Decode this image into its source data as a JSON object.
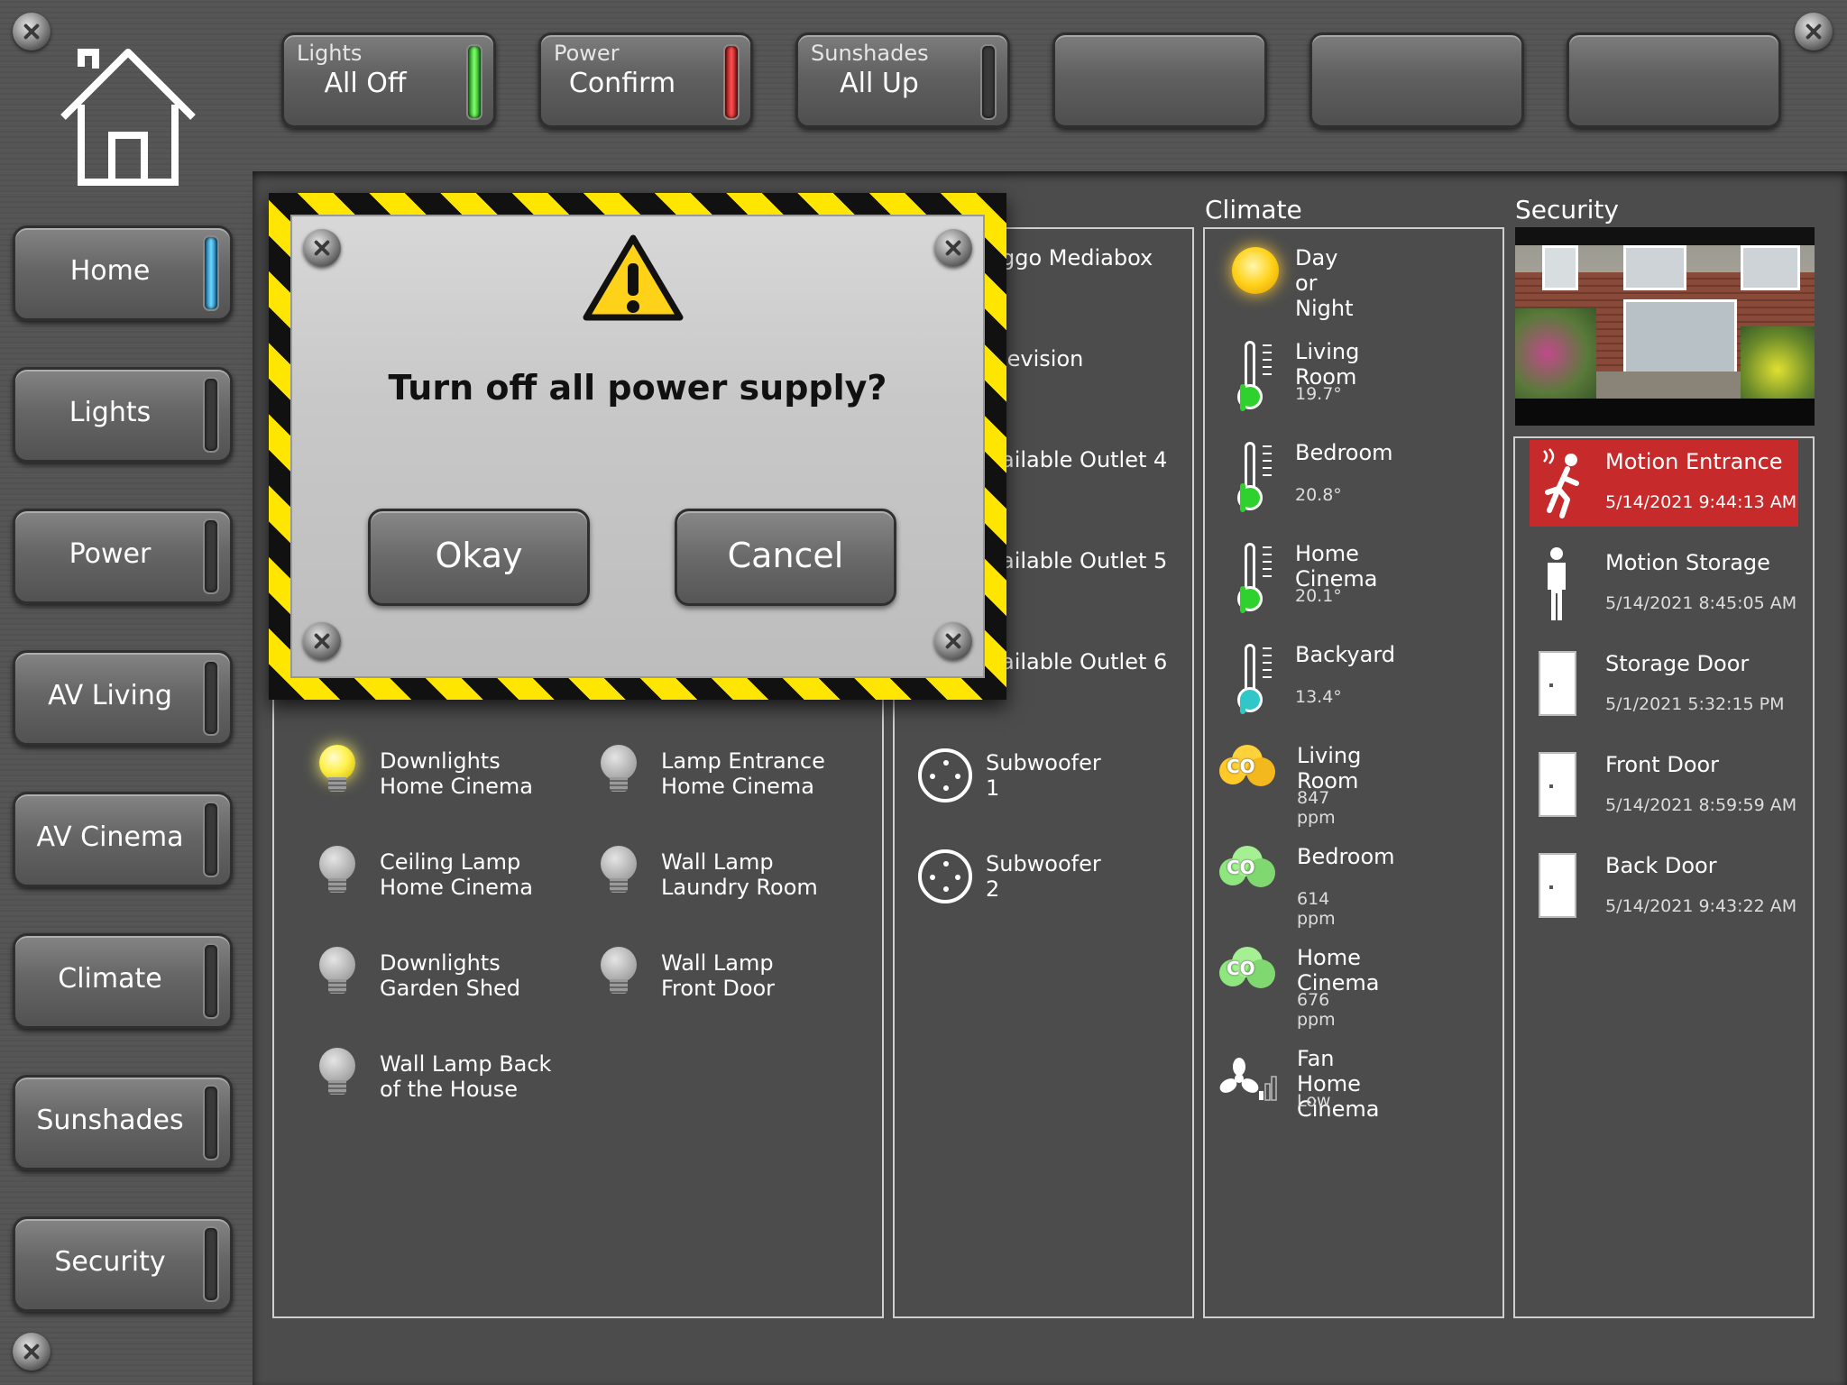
{
  "top_buttons": [
    {
      "caption": "Lights",
      "value": "All Off",
      "indicator": "green"
    },
    {
      "caption": "Power",
      "value": "Confirm",
      "indicator": "red"
    },
    {
      "caption": "Sunshades",
      "value": "All Up",
      "indicator": "gray"
    },
    {
      "caption": "",
      "value": ""
    },
    {
      "caption": "",
      "value": ""
    },
    {
      "caption": "",
      "value": ""
    }
  ],
  "nav": [
    {
      "label": "Home",
      "active": true
    },
    {
      "label": "Lights"
    },
    {
      "label": "Power"
    },
    {
      "label": "AV Living"
    },
    {
      "label": "AV Cinema"
    },
    {
      "label": "Climate"
    },
    {
      "label": "Sunshades"
    },
    {
      "label": "Security"
    }
  ],
  "lights": [
    {
      "line1": "Downlights",
      "line2": "Home Cinema",
      "on": true
    },
    {
      "line1": "Lamp Entrance",
      "line2": "Home Cinema",
      "on": false
    },
    {
      "line1": "Ceiling Lamp",
      "line2": "Home Cinema",
      "on": false
    },
    {
      "line1": "Wall Lamp",
      "line2": "Laundry Room",
      "on": false
    },
    {
      "line1": "Downlights",
      "line2": "Garden Shed",
      "on": false
    },
    {
      "line1": "Wall Lamp",
      "line2": "Front Door",
      "on": false
    },
    {
      "line1": "Wall Lamp Back",
      "line2": "of the House",
      "on": false
    }
  ],
  "power": [
    {
      "label": "ggo Mediabox"
    },
    {
      "label": "levision"
    },
    {
      "label": "ailable Outlet 4"
    },
    {
      "label": "ailable Outlet 5"
    },
    {
      "label": "ailable Outlet 6"
    },
    {
      "label": "Subwoofer 1"
    },
    {
      "label": "Subwoofer 2"
    }
  ],
  "climate": {
    "title": "Climate",
    "day_night": "Day or Night",
    "temperatures": [
      {
        "name": "Living Room",
        "value": "19.7°",
        "color": "#2fd12f"
      },
      {
        "name": "Bedroom",
        "value": "20.8°",
        "color": "#2fd12f"
      },
      {
        "name": "Home Cinema",
        "value": "20.1°",
        "color": "#2fd12f"
      },
      {
        "name": "Backyard",
        "value": "13.4°",
        "color": "#2fc7c7"
      }
    ],
    "co2": [
      {
        "name": "Living Room",
        "value": "847 ppm",
        "level": "yellow"
      },
      {
        "name": "Bedroom",
        "value": "614 ppm",
        "level": "green"
      },
      {
        "name": "Home Cinema",
        "value": "676 ppm",
        "level": "green"
      }
    ],
    "co2_glyph": "CO",
    "fan": {
      "name": "Fan Home Cinema",
      "value": "Low"
    }
  },
  "security": {
    "title": "Security",
    "events": [
      {
        "name": "Motion Entrance",
        "time": "5/14/2021 9:44:13 AM",
        "alert": true,
        "icon": "motion-running-icon"
      },
      {
        "name": "Motion Storage",
        "time": "5/14/2021 8:45:05 AM",
        "alert": false,
        "icon": "person-standing-icon"
      },
      {
        "name": "Storage Door",
        "time": "5/1/2021 5:32:15 PM",
        "alert": false,
        "icon": "door-icon"
      },
      {
        "name": "Front Door",
        "time": "5/14/2021 8:59:59 AM",
        "alert": false,
        "icon": "door-icon"
      },
      {
        "name": "Back Door",
        "time": "5/14/2021 9:43:22 AM",
        "alert": false,
        "icon": "door-icon"
      }
    ]
  },
  "dialog": {
    "message": "Turn off all power supply?",
    "ok": "Okay",
    "cancel": "Cancel"
  },
  "colors": {
    "alert": "#c62a2a",
    "stripe_yellow": "#ffe600"
  }
}
